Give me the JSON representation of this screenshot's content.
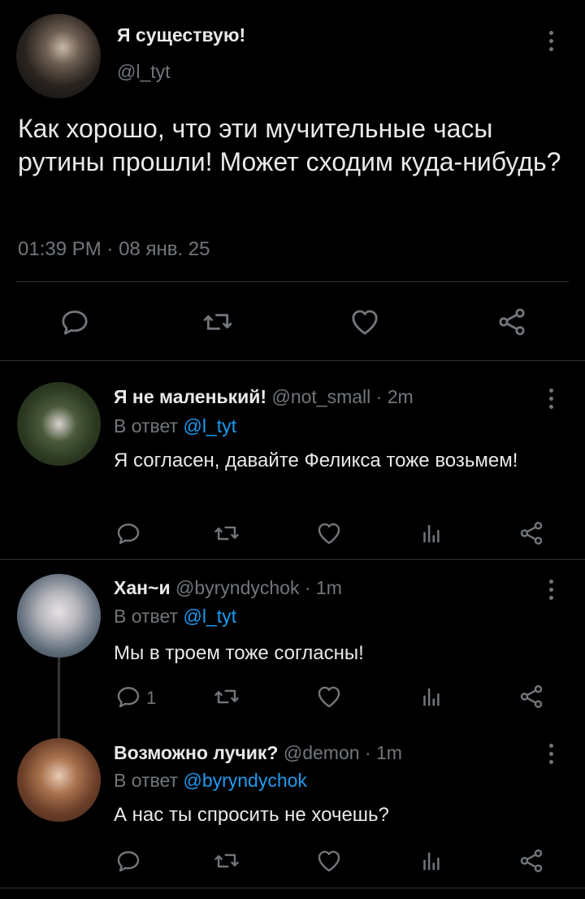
{
  "main_tweet": {
    "author_name": "Я существую!",
    "handle": "@l_tyt",
    "text": "Как хорошо, что эти мучительные часы рутины прошли! Может сходим куда-нибудь?",
    "time": "01:39 PM",
    "dot": "·",
    "date": "08 янв. 25"
  },
  "replies": [
    {
      "author_name": "Я не маленький!",
      "handle": "@not_small",
      "time": "· 2m",
      "reply_prefix": "В ответ",
      "reply_to": "@l_tyt",
      "text": "Я согласен, давайте Феликса тоже возьмем!",
      "reply_count": ""
    },
    {
      "author_name": "Хан~и",
      "handle": "@byryndychok",
      "time": "· 1m",
      "reply_prefix": "В ответ",
      "reply_to": "@l_tyt",
      "text": "Мы в троем тоже согласны!",
      "reply_count": "1"
    },
    {
      "author_name": "Возможно лучик?",
      "handle": "@demon",
      "time": "· 1m",
      "reply_prefix": "В ответ",
      "reply_to": "@byryndychok",
      "text": "А нас ты спросить не хочешь?",
      "reply_count": ""
    }
  ],
  "icons": [
    "reply-icon",
    "retweet-icon",
    "like-icon",
    "share-icon",
    "analytics-icon",
    "more-icon"
  ],
  "colors": {
    "background": "#000000",
    "text": "#e7e9ea",
    "muted": "#71767b",
    "link": "#1d9bf0",
    "divider": "#2f3336"
  }
}
